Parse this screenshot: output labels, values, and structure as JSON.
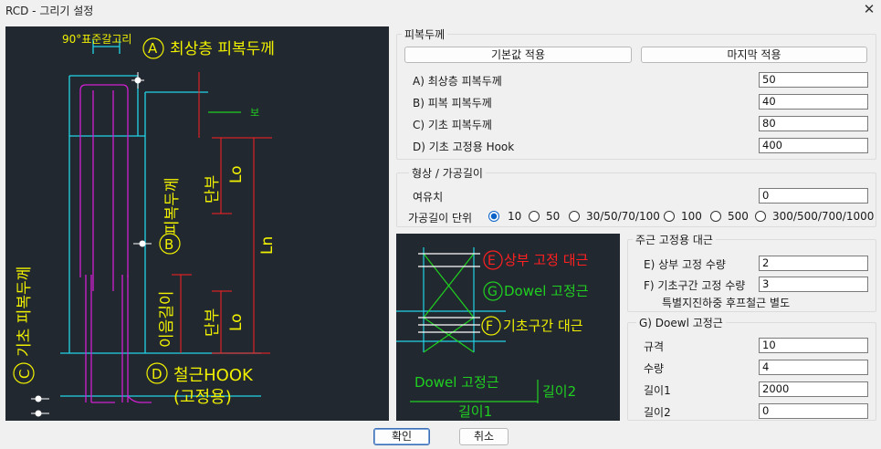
{
  "window": {
    "title": "RCD - 그리기 설정",
    "close_icon": "close-icon"
  },
  "colors": {
    "cad_bg": "#212830",
    "cyan": "#22d3e6",
    "magenta": "#d020d0",
    "yellow": "#f0f000",
    "red": "#ff2020",
    "green": "#20d020",
    "white": "#ffffff",
    "accent": "#0a64c8"
  },
  "main_drawing": {
    "bend_label": "90°표준갈고리",
    "label_a": "A",
    "top_cover": "최상층  피복두께",
    "beam_label": "보",
    "side_cover": "피복두께",
    "label_b": "B",
    "tip_upper": "단부",
    "lo_upper": "Lo",
    "ln_label": "Ln",
    "lap_label": "이음길이",
    "tip_lower": "단부",
    "lo_lower": "Lo",
    "foot_cover": "기초  피복두께",
    "label_c": "C",
    "label_d": "D",
    "hook_label": "철근HOOK",
    "hook_sub": "(고정용)"
  },
  "small_drawing": {
    "label_e": "E",
    "top_fix": "상부  고정  대근",
    "label_g": "G",
    "dowel": "Dowel  고정근",
    "label_f": "F",
    "foot_bar": "기초구간  대근",
    "dowel_legend": "Dowel  고정근",
    "len2": "길이2",
    "len1": "길이1"
  },
  "cover_group": {
    "title": "피복두께",
    "default_button": "기본값 적용",
    "last_button": "마지막 적용",
    "rows": [
      {
        "label": "A) 최상층 피복두께",
        "value": "50"
      },
      {
        "label": "B) 피복 피복두께",
        "value": "40"
      },
      {
        "label": "C) 기초 피복두께",
        "value": "80"
      },
      {
        "label": "D) 기초 고정용 Hook",
        "value": "400"
      }
    ]
  },
  "shape_group": {
    "title": "형상 / 가공길이",
    "margin_label": "여유치",
    "margin_value": "0",
    "unit_label": "가공길이 단위",
    "options": [
      "10",
      "50",
      "30/50/70/100",
      "100",
      "500",
      "300/500/700/1000"
    ],
    "selected": "10"
  },
  "main_fix_group": {
    "title": "주근 고정용 대근",
    "upper_label": "E) 상부 고정 수량",
    "upper_value": "2",
    "foot_label": "F) 기초구간 고정 수량",
    "foot_value": "3",
    "note": "특별지진하중 후프철근 별도"
  },
  "dowel_group": {
    "title": "G) Doewl 고정근",
    "rows": [
      {
        "label": "규격",
        "value": "10"
      },
      {
        "label": "수량",
        "value": "4"
      },
      {
        "label": "길이1",
        "value": "2000"
      },
      {
        "label": "길이2",
        "value": "0"
      }
    ]
  },
  "footer": {
    "ok": "확인",
    "cancel": "취소"
  }
}
